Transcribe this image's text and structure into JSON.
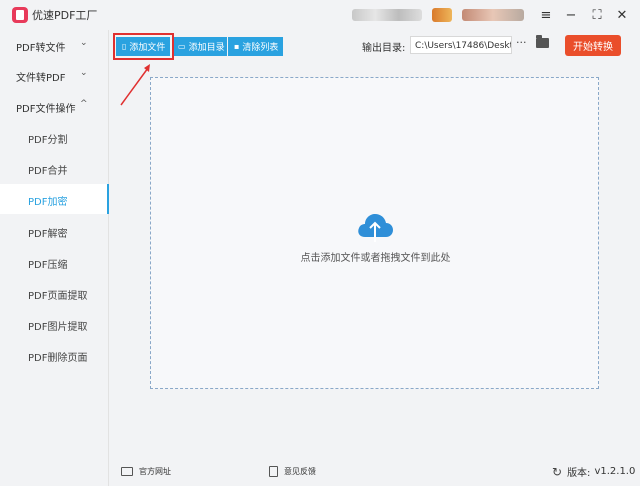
{
  "app": {
    "title": "优速PDF工厂"
  },
  "window": {
    "menu_icon": "menu-icon",
    "minimize_icon": "minimize-icon",
    "maximize_icon": "maximize-icon",
    "close_icon": "close-icon"
  },
  "sidebar": {
    "groups": [
      {
        "label": "PDF转文件",
        "chevron": "⌄"
      },
      {
        "label": "文件转PDF",
        "chevron": "⌄"
      },
      {
        "label": "PDF文件操作",
        "chevron": "^"
      }
    ],
    "sub_items": [
      {
        "label": "PDF分割"
      },
      {
        "label": "PDF合并"
      },
      {
        "label": "PDF加密",
        "active": true
      },
      {
        "label": "PDF解密"
      },
      {
        "label": "PDF压缩"
      },
      {
        "label": "PDF页面提取"
      },
      {
        "label": "PDF图片提取"
      },
      {
        "label": "PDF删除页面"
      }
    ],
    "active_color": "#2aa2e0"
  },
  "toolbar": {
    "add_file_label": "添加文件",
    "add_folder_label": "添加目录",
    "clear_list_label": "清除列表",
    "accent": "#2aa2e0"
  },
  "output": {
    "label": "输出目录:",
    "path_value": "C:\\Users\\17486\\Deskto",
    "more_label": "···",
    "start_label": "开始转换",
    "start_color": "#ea4e2b"
  },
  "drop_zone": {
    "hint": "点击添加文件或者拖拽文件到此处",
    "icon": "cloud-upload-icon"
  },
  "footer": {
    "website_label": "官方网址",
    "feedback_label": "意见反馈",
    "version_label": "版本:",
    "version_value": "v1.2.1.0"
  }
}
